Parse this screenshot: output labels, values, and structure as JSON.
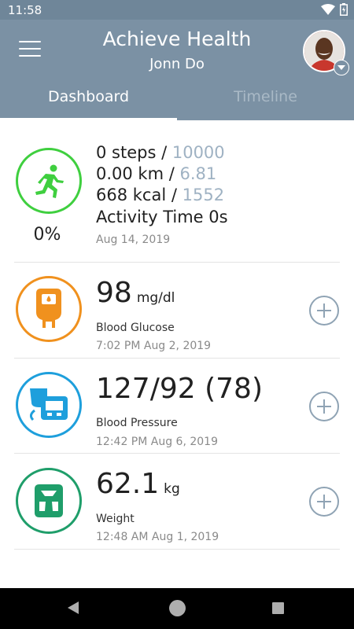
{
  "status_bar": {
    "time": "11:58"
  },
  "header": {
    "title": "Achieve Health",
    "subtitle": "Jonn Do",
    "color": "#7b91a4"
  },
  "tabs": [
    {
      "label": "Dashboard",
      "active": true
    },
    {
      "label": "Timeline",
      "active": false
    }
  ],
  "activity": {
    "steps": "0 steps",
    "steps_goal": "10000",
    "distance": "0.00 km",
    "distance_goal": "6.81",
    "calories": "668 kcal",
    "calories_goal": "1552",
    "activity_time": "Activity Time 0s",
    "percent": "0%",
    "date": "Aug 14, 2019",
    "color": "#3fcf3f"
  },
  "glucose": {
    "value": "98",
    "unit": "mg/dl",
    "label": "Blood Glucose",
    "timestamp": "7:02 PM Aug 2, 2019",
    "color": "#f0911e"
  },
  "pressure": {
    "value": "127/92 (78)",
    "label": "Blood Pressure",
    "timestamp": "12:42 PM Aug 6, 2019",
    "color": "#1e9fdc"
  },
  "weight": {
    "value": "62.1",
    "unit": "kg",
    "label": "Weight",
    "timestamp": "12:48 AM Aug 1, 2019",
    "color": "#1f9e6a"
  }
}
